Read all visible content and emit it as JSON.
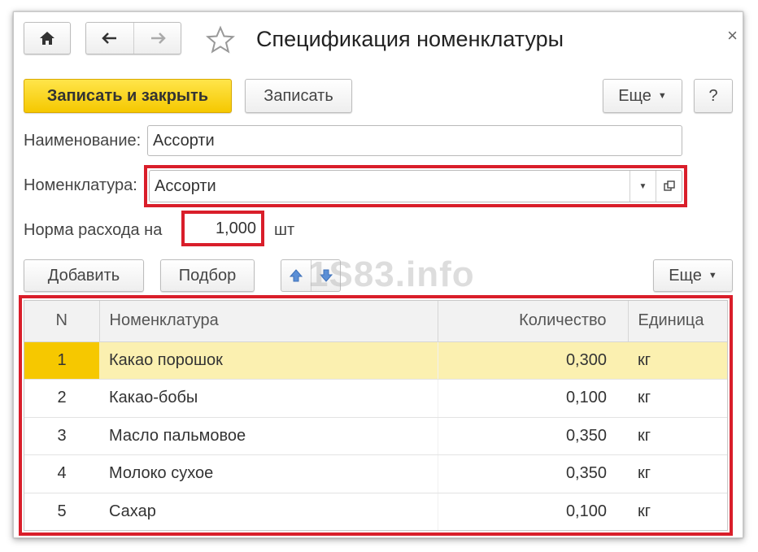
{
  "window": {
    "title": "Спецификация номенклатуры",
    "close_glyph": "×"
  },
  "toolbar": {
    "save_close_label": "Записать и закрыть",
    "save_label": "Записать",
    "more_label": "Еще",
    "help_label": "?"
  },
  "form": {
    "name_label": "Наименование:",
    "name_value": "Ассорти",
    "nomenclature_label": "Номенклатура:",
    "nomenclature_value": "Ассорти",
    "norm_label": "Норма расхода на",
    "norm_value": "1,000",
    "norm_unit": "шт"
  },
  "table_toolbar": {
    "add_label": "Добавить",
    "pick_label": "Подбор",
    "more_label": "Еще"
  },
  "table": {
    "columns": [
      "N",
      "Номенклатура",
      "Количество",
      "Единица"
    ],
    "rows": [
      {
        "n": "1",
        "name": "Какао порошок",
        "qty": "0,300",
        "unit": "кг"
      },
      {
        "n": "2",
        "name": "Какао-бобы",
        "qty": "0,100",
        "unit": "кг"
      },
      {
        "n": "3",
        "name": "Масло пальмовое",
        "qty": "0,350",
        "unit": "кг"
      },
      {
        "n": "4",
        "name": "Молоко сухое",
        "qty": "0,350",
        "unit": "кг"
      },
      {
        "n": "5",
        "name": "Сахар",
        "qty": "0,100",
        "unit": "кг"
      }
    ],
    "selected_row": 1
  },
  "watermark": "1S83.info",
  "colors": {
    "accent": "#f5c800",
    "highlight": "#d91e2a",
    "selected_row": "#fbf0b0"
  }
}
